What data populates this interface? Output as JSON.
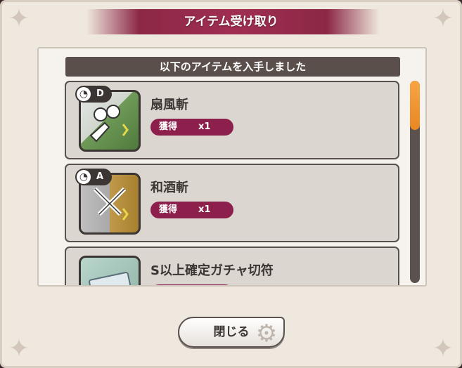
{
  "dialog": {
    "title": "アイテム受け取り",
    "header": "以下のアイテムを入手しました",
    "close_label": "閉じる"
  },
  "items": [
    {
      "rank": "D",
      "name": "扇風斬",
      "acquire_label": "獲得",
      "count": "x1",
      "icon": "fan-slash-skill-icon",
      "color": "#5f8a4a"
    },
    {
      "rank": "A",
      "name": "和酒斬",
      "acquire_label": "獲得",
      "count": "x1",
      "icon": "crossed-swords-skill-icon",
      "color": "#b08a3c"
    },
    {
      "name": "S以上確定ガチャ切符",
      "icon": "gacha-ticket-icon",
      "color": "#8fb2a7"
    }
  ],
  "colors": {
    "accent": "#8c1f4c",
    "scroll_thumb": "#f0982f",
    "card_border": "#57504c"
  }
}
